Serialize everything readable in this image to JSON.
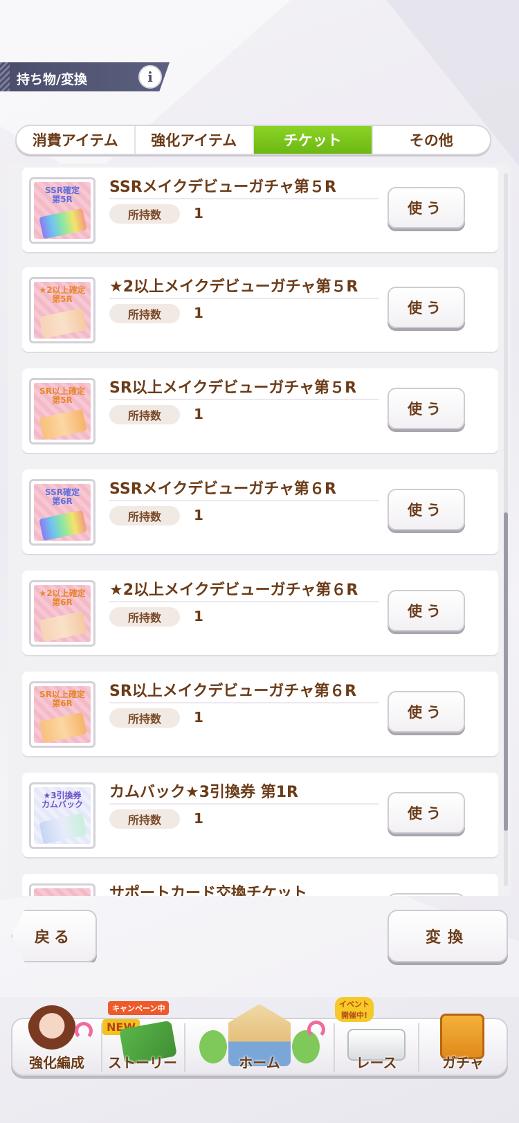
{
  "header": {
    "title": "持ち物/変換",
    "info_icon": "i"
  },
  "tabs": [
    {
      "label": "消費アイテム",
      "active": false
    },
    {
      "label": "強化アイテム",
      "active": false
    },
    {
      "label": "チケット",
      "active": true
    },
    {
      "label": "その他",
      "active": false
    }
  ],
  "items": [
    {
      "name": "SSRメイクデビューガチャ第５R",
      "thumb_label": "SSR確定\n第5R",
      "thumb_style": "ssr",
      "own_label": "所持数",
      "count": "1",
      "use_label": "使う"
    },
    {
      "name": "★2以上メイクデビューガチャ第５R",
      "thumb_label": "★2以上確定\n第5R",
      "thumb_style": "star2",
      "own_label": "所持数",
      "count": "1",
      "use_label": "使う"
    },
    {
      "name": "SR以上メイクデビューガチャ第５R",
      "thumb_label": "SR以上確定\n第5R",
      "thumb_style": "sr",
      "own_label": "所持数",
      "count": "1",
      "use_label": "使う"
    },
    {
      "name": "SSRメイクデビューガチャ第６R",
      "thumb_label": "SSR確定\n第6R",
      "thumb_style": "ssr",
      "own_label": "所持数",
      "count": "1",
      "use_label": "使う"
    },
    {
      "name": "★2以上メイクデビューガチャ第６R",
      "thumb_label": "★2以上確定\n第6R",
      "thumb_style": "star2",
      "own_label": "所持数",
      "count": "1",
      "use_label": "使う"
    },
    {
      "name": "SR以上メイクデビューガチャ第６R",
      "thumb_label": "SR以上確定\n第6R",
      "thumb_style": "sr",
      "own_label": "所持数",
      "count": "1",
      "use_label": "使う"
    },
    {
      "name": "カムバック★3引換券 第1R",
      "thumb_label": "★3引換券\nカムバック",
      "thumb_style": "comeback",
      "own_label": "所持数",
      "count": "1",
      "use_label": "使う"
    },
    {
      "name": "サポートカード交換チケット",
      "thumb_label": "",
      "thumb_style": "support",
      "own_label": "",
      "count": "",
      "use_label": ""
    }
  ],
  "buttons": {
    "back": "戻る",
    "convert": "変換"
  },
  "nav": {
    "items": [
      {
        "label": "強化編成"
      },
      {
        "label": "ストーリー",
        "badge_campaign": "キャンペーン中",
        "badge_new": "NEW"
      },
      {
        "label": "ホーム"
      },
      {
        "label": "レース",
        "badge_event": "イベント\n開催中!"
      },
      {
        "label": "ガチャ"
      }
    ]
  },
  "colors": {
    "accent_green": "#7cc51c",
    "text_brown": "#6b3b18",
    "header_slate": "#4e5170"
  }
}
